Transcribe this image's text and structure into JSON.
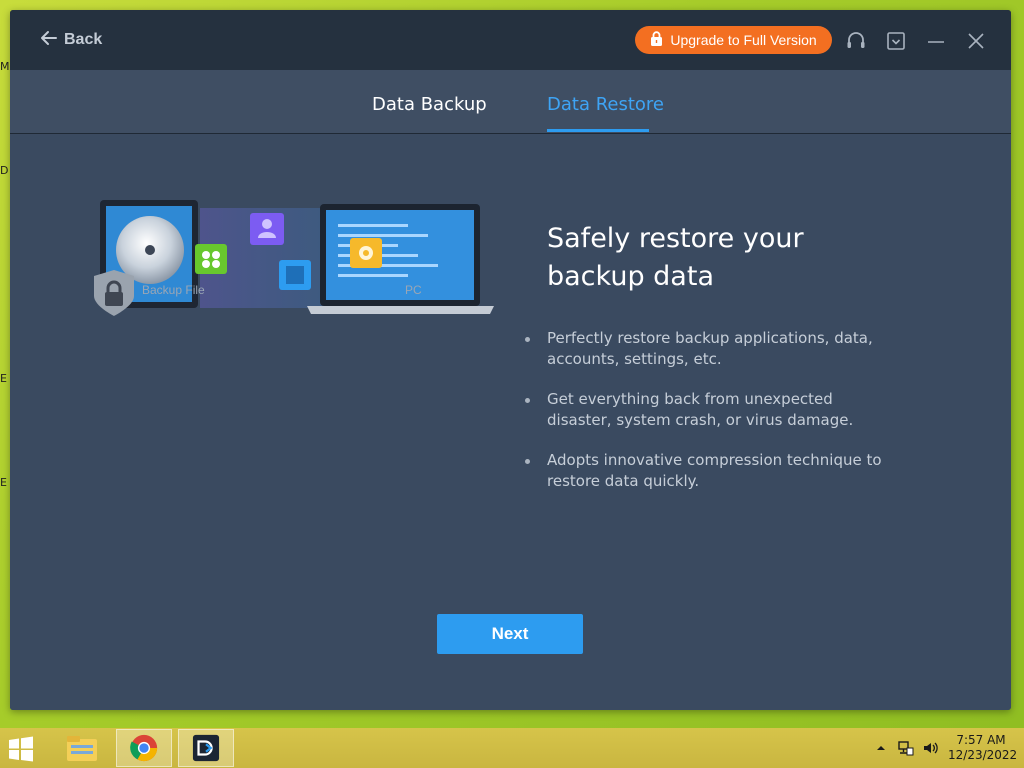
{
  "window": {
    "back_label": "Back",
    "upgrade_label": "Upgrade to Full Version"
  },
  "tabs": [
    {
      "label": "Data Backup",
      "active": false
    },
    {
      "label": "Data Restore",
      "active": true
    }
  ],
  "illustration": {
    "source_label": "Backup File",
    "target_label": "PC"
  },
  "main": {
    "heading": "Safely restore your backup data",
    "features": [
      "Perfectly restore backup applications, data, accounts, settings, etc.",
      "Get everything back from unexpected disaster, system crash, or virus damage.",
      "Adopts innovative compression technique to restore data quickly."
    ],
    "next_label": "Next"
  },
  "taskbar": {
    "time": "7:57 AM",
    "date": "12/23/2022"
  },
  "colors": {
    "accent": "#2d9cf0",
    "upgrade": "#f36f21",
    "titlebar": "#25313f",
    "window_bg": "#3b4a60"
  }
}
